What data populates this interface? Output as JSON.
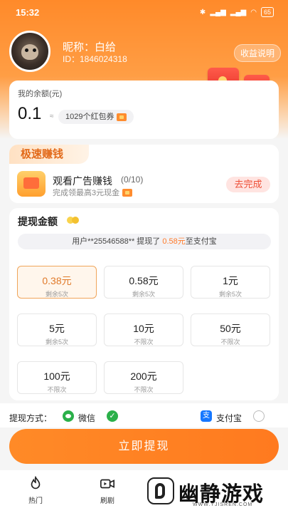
{
  "status_bar": {
    "time": "15:32",
    "battery": "65"
  },
  "profile": {
    "nickname": "昵称：白给",
    "user_id": "ID：1846024318",
    "income_btn": "收益说明"
  },
  "balance": {
    "label": "我的余额(元)",
    "value": "0.1",
    "approx": "≈",
    "coupons": "1029个红包券"
  },
  "speed_earn": {
    "tag": "极速赚钱",
    "task_title": "观看广告赚钱",
    "task_count": "(0/10)",
    "task_sub": "完成领最高3元现金",
    "go_btn": "去完成"
  },
  "withdraw": {
    "title": "提现金额",
    "ticker": {
      "prefix": "用户**25546588** 提现了",
      "amount": "0.58元",
      "suffix": "至支付宝"
    },
    "options": [
      {
        "value": "0.38元",
        "sub": "剩余5次",
        "selected": true
      },
      {
        "value": "0.58元",
        "sub": "剩余5次",
        "selected": false
      },
      {
        "value": "1元",
        "sub": "剩余5次",
        "selected": false
      },
      {
        "value": "5元",
        "sub": "剩余5次",
        "selected": false
      },
      {
        "value": "10元",
        "sub": "不限次",
        "selected": false
      },
      {
        "value": "50元",
        "sub": "不限次",
        "selected": false
      },
      {
        "value": "100元",
        "sub": "不限次",
        "selected": false
      },
      {
        "value": "200元",
        "sub": "不限次",
        "selected": false
      }
    ]
  },
  "method": {
    "label": "提现方式：",
    "wechat": "微信",
    "alipay": "支付宝",
    "alipay_icon": "支"
  },
  "cta": "立即提现",
  "tabs": [
    {
      "label": "热门",
      "icon": "flame-icon"
    },
    {
      "label": "刷剧",
      "icon": "video-icon"
    }
  ],
  "watermark": {
    "text": "幽静游戏",
    "url": "WWW.YJISREN.COM"
  },
  "colors": {
    "accent": "#ff8a2a",
    "wechat": "#2bb04a",
    "alipay": "#1677ff"
  }
}
